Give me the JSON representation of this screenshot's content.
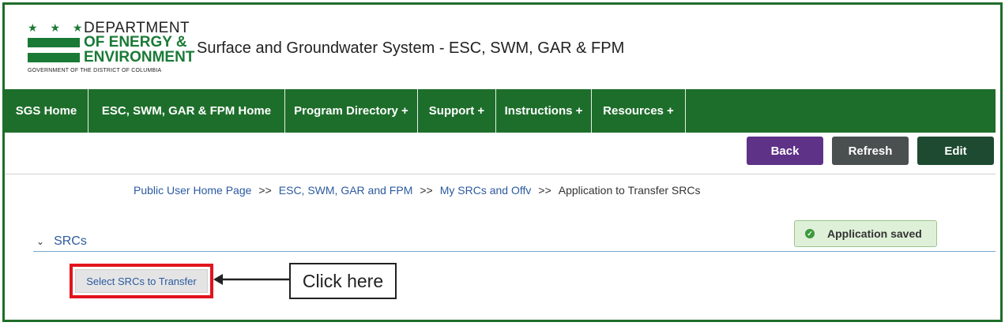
{
  "logo": {
    "line1": "DEPARTMENT",
    "line2": "OF ENERGY &",
    "line3": "ENVIRONMENT",
    "line4": "GOVERNMENT OF THE DISTRICT OF COLUMBIA",
    "stars": "★ ★ ★"
  },
  "header": {
    "title": "Surface and Groundwater System - ESC, SWM, GAR & FPM"
  },
  "nav": {
    "items": [
      {
        "label": "SGS Home"
      },
      {
        "label": "ESC, SWM, GAR & FPM Home"
      },
      {
        "label": "Program Directory +"
      },
      {
        "label": "Support +"
      },
      {
        "label": "Instructions +"
      },
      {
        "label": "Resources +"
      }
    ]
  },
  "toolbar": {
    "back_label": "Back",
    "refresh_label": "Refresh",
    "edit_label": "Edit"
  },
  "breadcrumb": {
    "items": [
      "Public User Home Page",
      "ESC, SWM, GAR and FPM",
      "My SRCs and Offv",
      "Application to Transfer SRCs"
    ],
    "separator": ">>"
  },
  "section": {
    "title": "SRCs",
    "chevron": "⌄"
  },
  "status": {
    "message": "Application saved",
    "icon": "check-circle-icon"
  },
  "actions": {
    "select_label": "Select SRCs to Transfer"
  },
  "annotation": {
    "callout": "Click here"
  },
  "colors": {
    "nav": "#1e6e2b",
    "back": "#5e3286",
    "refresh": "#4a4f50",
    "edit": "#1d4a30",
    "link": "#2c5aa0",
    "highlight": "#e1141d",
    "success_bg": "#dff0d8"
  }
}
